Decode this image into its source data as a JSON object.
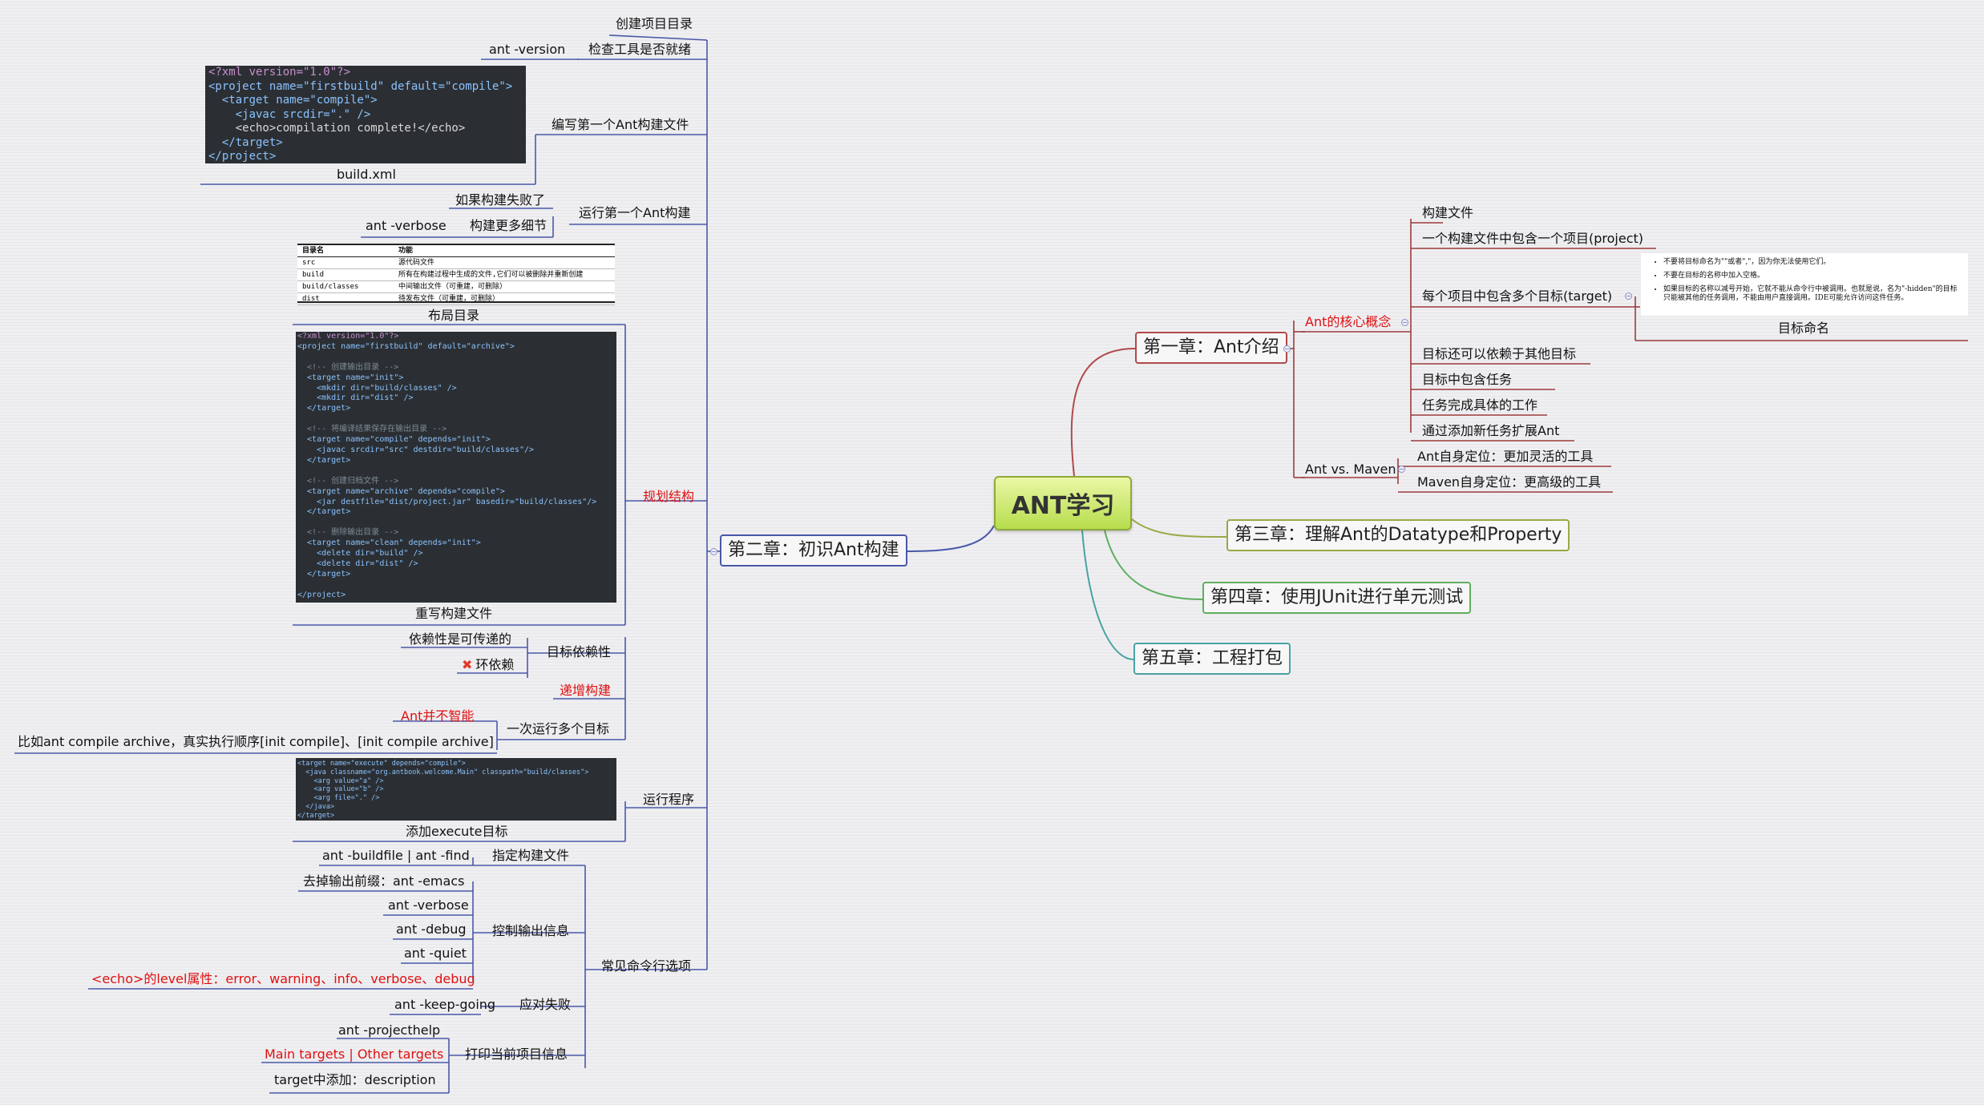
{
  "root": "ANT学习",
  "chapters": {
    "ch1": "第一章：Ant介绍",
    "ch2": "第二章：初识Ant构建",
    "ch3": "第三章：理解Ant的Datatype和Property",
    "ch4": "第四章：使用JUnit进行单元测试",
    "ch5": "第五章：工程打包"
  },
  "ch1_nodes": {
    "core": "Ant的核心概念",
    "build_file": "构建文件",
    "one_project": "一个构建文件中包含一个项目(project)",
    "targets": "每个项目中包含多个目标(target)",
    "target_naming": "目标命名",
    "depends": "目标还可以依赖于其他目标",
    "tasks": "目标中包含任务",
    "task_work": "任务完成具体的工作",
    "extend": "通过添加新任务扩展Ant",
    "vs_maven": "Ant vs. Maven",
    "ant_pos": "Ant自身定位：更加灵活的工具",
    "maven_pos": "Maven自身定位：更高级的工具",
    "naming_notes": [
      "不要将目标命名为\"\"或者\",\"，因为你无法使用它们。",
      "不要在目标的名称中加入空格。",
      "如果目标的名称以减号开始，它就不能从命令行中被调用。也就是说，名为\"-hidden\"的目标只能被其他的任务调用，不能由用户直接调用。IDE可能允许访问这件任务。"
    ]
  },
  "ch2_nodes": {
    "create_dir": "创建项目目录",
    "check_tool": "检查工具是否就绪",
    "ant_version": "ant -version",
    "write_first": "编写第一个Ant构建文件",
    "build_xml": "build.xml",
    "run_first": "运行第一个Ant构建",
    "if_fail": "如果构建失败了",
    "more_detail": "构建更多细节",
    "ant_verbose": "ant -verbose",
    "layout_dir": "布局目录",
    "plan_structure": "规划结构",
    "rewrite_build": "重写构建文件",
    "target_depends": "目标依赖性",
    "transitive": "依赖性是可传递的",
    "cyclic": "环依赖",
    "incremental": "递增构建",
    "multi_targets": "一次运行多个目标",
    "ant_not_smart": "Ant并不智能",
    "example_order": "比如ant compile archive，真实执行顺序[init compile]、[init compile archive]",
    "run_program": "运行程序",
    "add_execute": "添加execute目标",
    "common_options": "常见命令行选项",
    "specify_build": "指定构建文件",
    "buildfile_find": "ant -buildfile | ant -find",
    "control_output": "控制输出信息",
    "remove_prefix": "去掉输出前缀：ant -emacs",
    "opt_verbose": "ant -verbose",
    "opt_debug": "ant -debug",
    "opt_quiet": "ant -quiet",
    "echo_level": "<echo>的level属性：error、warning、info、verbose、debug",
    "handle_fail": "应对失败",
    "keep_going": "ant -keep-going",
    "print_info": "打印当前项目信息",
    "projecthelp": "ant -projecthelp",
    "main_other": "Main targets | Other targets",
    "description": "target中添加：description"
  },
  "layout_table": {
    "header": [
      "目录名",
      "功能"
    ],
    "rows": [
      [
        "src",
        "源代码文件"
      ],
      [
        "build",
        "所有在构建过程中生成的文件,它们可以被删除并重新创建"
      ],
      [
        "build/classes",
        "中间输出文件（可重建，可删除）"
      ],
      [
        "dist",
        "待发布文件（可重建，可删除）"
      ]
    ]
  },
  "code": {
    "xml_decl": "<?xml version=\"1.0\"?>",
    "project_open": "<project name=\"firstbuild\" default=\"compile\">",
    "target_compile": "  <target name=\"compile\">",
    "javac": "    <javac srcdir=\".\" />",
    "echo": "    <echo>compilation complete!</echo>",
    "target_close": "  </target>",
    "project_close": "</project>"
  },
  "code2": [
    "<?xml version=\"1.0\"?>",
    "<project name=\"firstbuild\" default=\"archive\">",
    "",
    "  <!-- 创建输出目录 -->",
    "  <target name=\"init\">",
    "    <mkdir dir=\"build/classes\" />",
    "    <mkdir dir=\"dist\" />",
    "  </target>",
    "",
    "  <!-- 将编译结果保存在输出目录 -->",
    "  <target name=\"compile\" depends=\"init\">",
    "    <javac srcdir=\"src\" destdir=\"build/classes\"/>",
    "  </target>",
    "",
    "  <!-- 创建归档文件 -->",
    "  <target name=\"archive\" depends=\"compile\">",
    "    <jar destfile=\"dist/project.jar\" basedir=\"build/classes\"/>",
    "  </target>",
    "",
    "  <!-- 删除输出目录 -->",
    "  <target name=\"clean\" depends=\"init\">",
    "    <delete dir=\"build\" />",
    "    <delete dir=\"dist\" />",
    "  </target>",
    "",
    "</project>"
  ],
  "code3": [
    "<target name=\"execute\" depends=\"compile\">",
    "  <java classname=\"org.antbook.welcome.Main\" classpath=\"build/classes\">",
    "    <arg value=\"a\" />",
    "    <arg value=\"b\" />",
    "    <arg file=\".\" />",
    "  </java>",
    "</target>"
  ],
  "colors": {
    "ch1": "#b04a4a",
    "ch2": "#4a58a8",
    "ch3": "#9aa845",
    "ch4": "#5fae5f",
    "ch5": "#4aa3a3",
    "accent_red": "#e01010"
  }
}
